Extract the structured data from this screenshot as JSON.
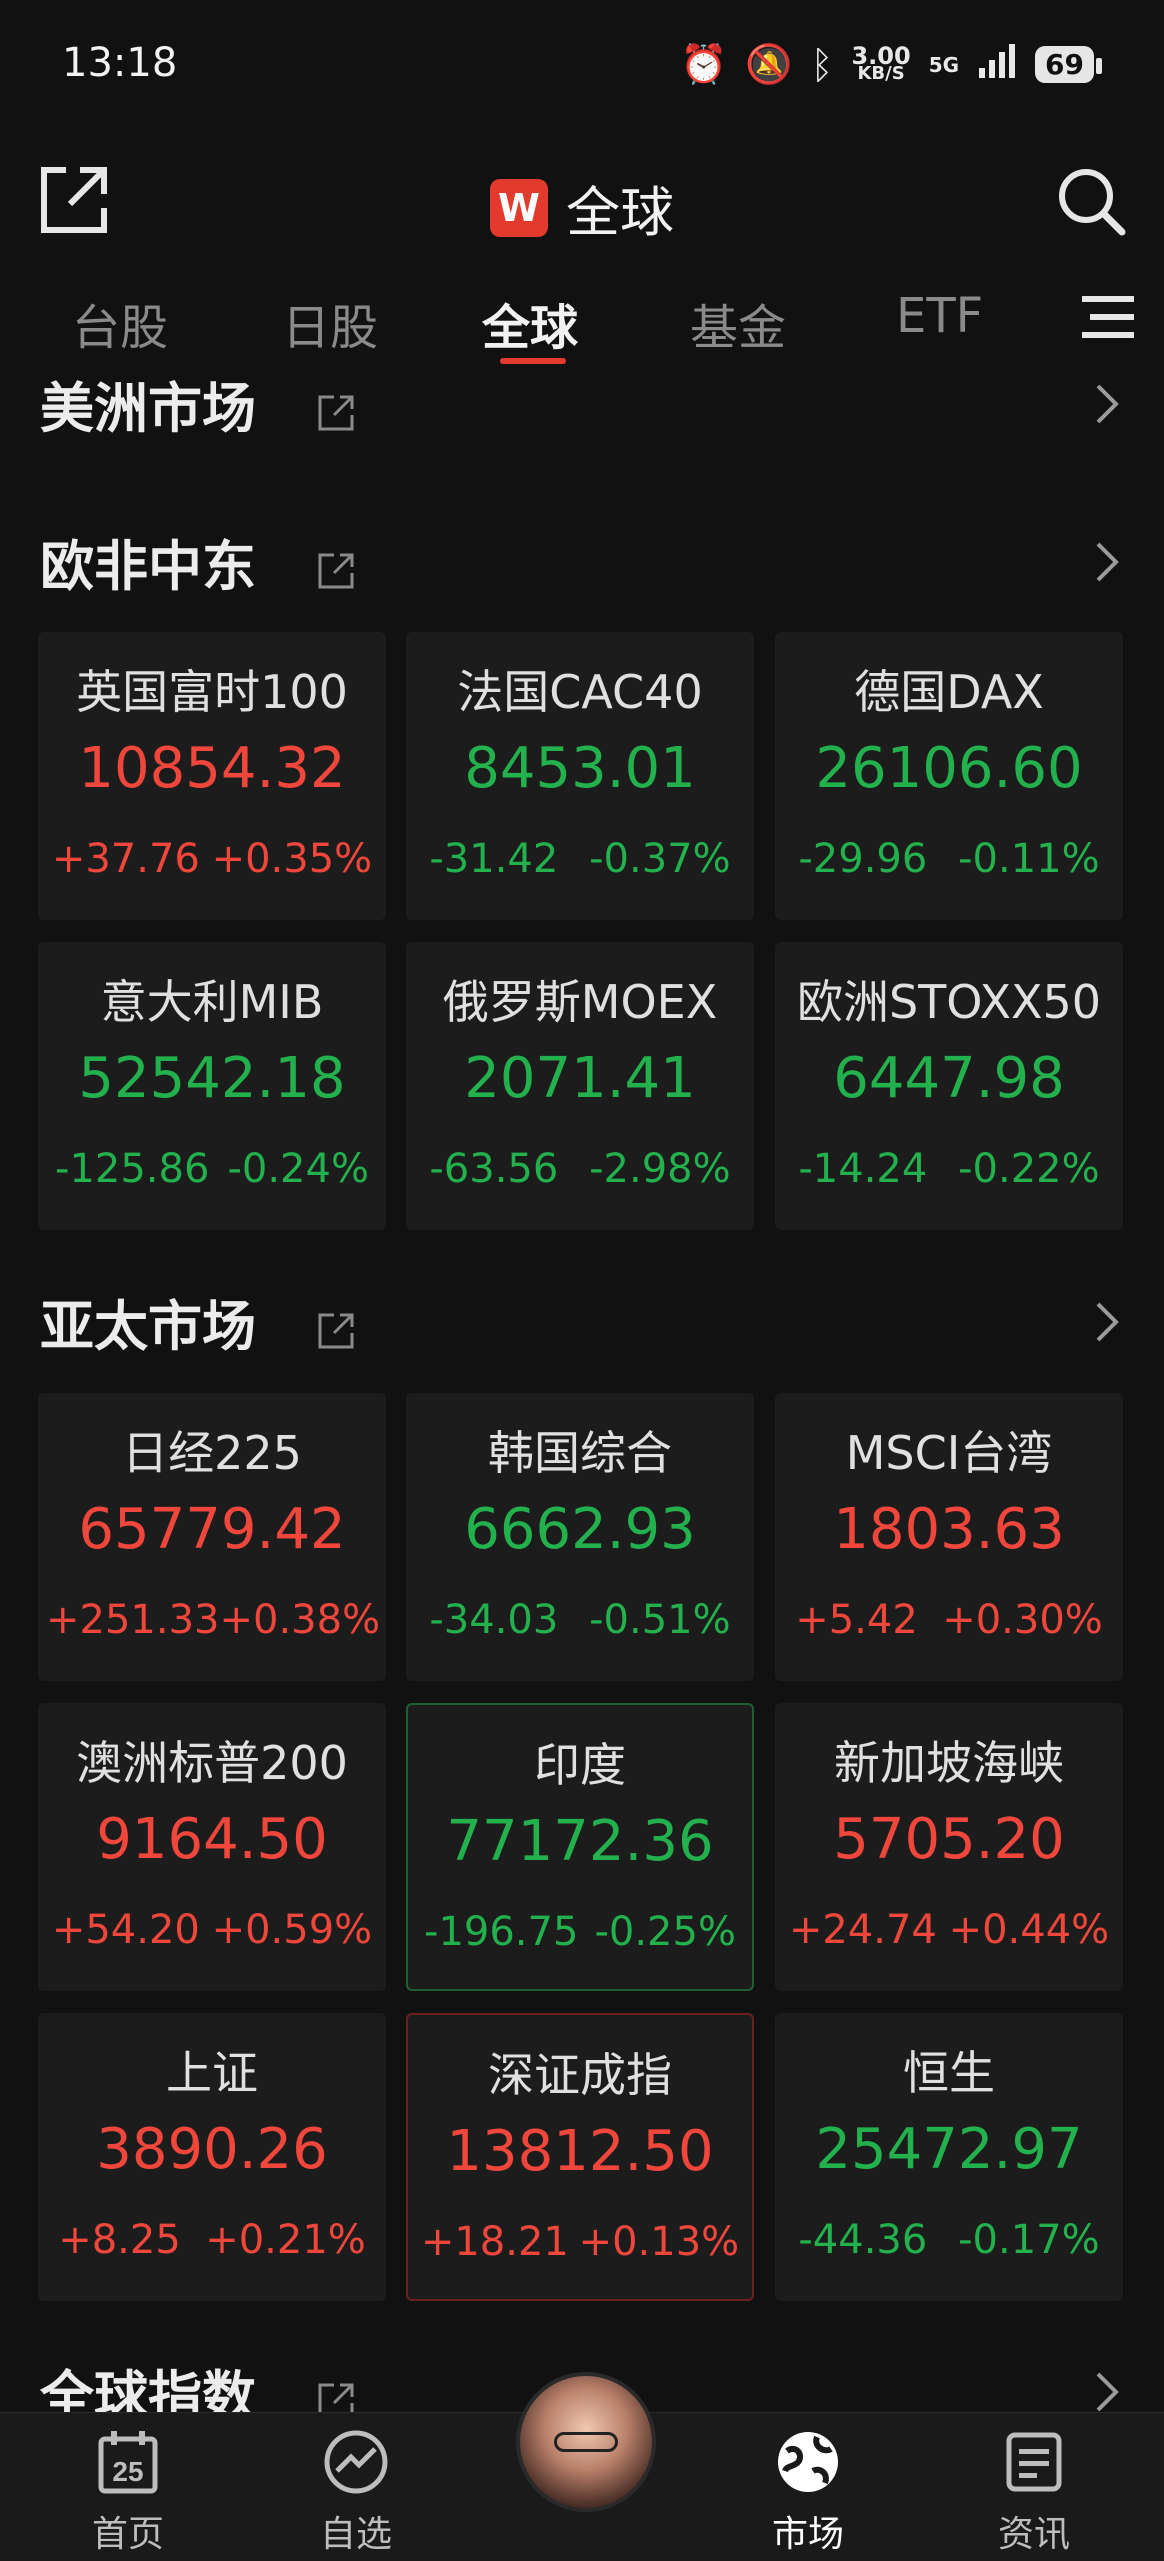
{
  "status_bar": {
    "time": "13:18",
    "net_speed_value": "3.00",
    "net_speed_unit": "KB/S",
    "signal": "5G",
    "battery": "69"
  },
  "header": {
    "title": "全球",
    "logo_letter": "W"
  },
  "tabs": [
    {
      "label": "台股"
    },
    {
      "label": "日股"
    },
    {
      "label": "全球",
      "active": true
    },
    {
      "label": "基金"
    },
    {
      "label": "ETF"
    }
  ],
  "sections": {
    "americas": {
      "title": "美洲市场"
    },
    "emea": {
      "title": "欧非中东",
      "cards": [
        {
          "name": "英国富时100",
          "price": "10854.32",
          "change": "+37.76",
          "pct": "+0.35%",
          "dir": "up"
        },
        {
          "name": "法国CAC40",
          "price": "8453.01",
          "change": "-31.42",
          "pct": "-0.37%",
          "dir": "down"
        },
        {
          "name": "德国DAX",
          "price": "26106.60",
          "change": "-29.96",
          "pct": "-0.11%",
          "dir": "down"
        },
        {
          "name": "意大利MIB",
          "price": "52542.18",
          "change": "-125.86",
          "pct": "-0.24%",
          "dir": "down"
        },
        {
          "name": "俄罗斯MOEX",
          "price": "2071.41",
          "change": "-63.56",
          "pct": "-2.98%",
          "dir": "down"
        },
        {
          "name": "欧洲STOXX50",
          "price": "6447.98",
          "change": "-14.24",
          "pct": "-0.22%",
          "dir": "down"
        }
      ]
    },
    "apac": {
      "title": "亚太市场",
      "cards": [
        {
          "name": "日经225",
          "price": "65779.42",
          "change": "+251.33",
          "pct": "+0.38%",
          "dir": "up"
        },
        {
          "name": "韩国综合",
          "price": "6662.93",
          "change": "-34.03",
          "pct": "-0.51%",
          "dir": "down"
        },
        {
          "name": "MSCI台湾",
          "price": "1803.63",
          "change": "+5.42",
          "pct": "+0.30%",
          "dir": "up"
        },
        {
          "name": "澳洲标普200",
          "price": "9164.50",
          "change": "+54.20",
          "pct": "+0.59%",
          "dir": "up"
        },
        {
          "name": "印度",
          "price": "77172.36",
          "change": "-196.75",
          "pct": "-0.25%",
          "dir": "down"
        },
        {
          "name": "新加坡海峡",
          "price": "5705.20",
          "change": "+24.74",
          "pct": "+0.44%",
          "dir": "up"
        },
        {
          "name": "上证",
          "price": "3890.26",
          "change": "+8.25",
          "pct": "+0.21%",
          "dir": "up"
        },
        {
          "name": "深证成指",
          "price": "13812.50",
          "change": "+18.21",
          "pct": "+0.13%",
          "dir": "up"
        },
        {
          "name": "恒生",
          "price": "25472.97",
          "change": "-44.36",
          "pct": "-0.17%",
          "dir": "down"
        }
      ]
    },
    "global": {
      "title": "全球指数"
    }
  },
  "bottom_nav": [
    {
      "label": "首页",
      "icon": "calendar-icon",
      "badge": "25"
    },
    {
      "label": "自选",
      "icon": "trend-icon"
    },
    {
      "label": "",
      "icon": "avatar"
    },
    {
      "label": "市场",
      "icon": "globe-icon",
      "active": true
    },
    {
      "label": "资讯",
      "icon": "news-icon"
    }
  ],
  "colors": {
    "up": "#f0463b",
    "down": "#22b14c",
    "accent": "#e23b2e",
    "background": "#111111",
    "card": "#1c1c1c"
  }
}
